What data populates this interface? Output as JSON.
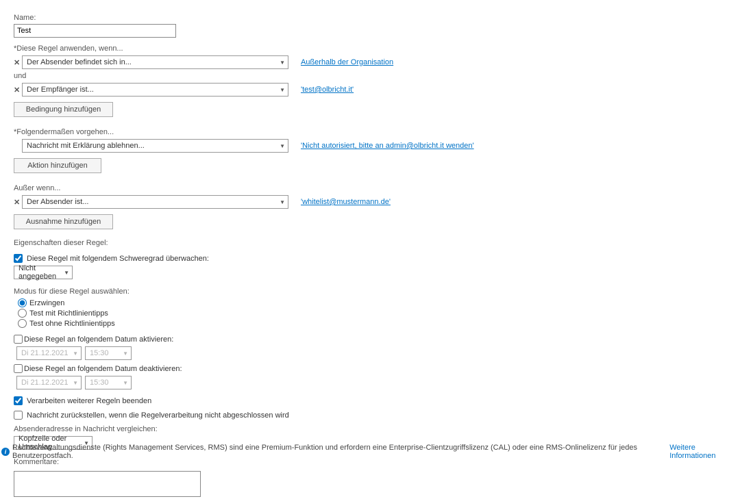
{
  "nameLabel": "Name:",
  "nameValue": "Test",
  "applyLabel": "*Diese Regel anwenden, wenn...",
  "condition1": {
    "dropdown": "Der Absender befindet sich in...",
    "link": "Außerhalb der Organisation"
  },
  "andLabel": "und",
  "condition2": {
    "dropdown": "Der Empfänger ist...",
    "link": "'test@olbricht.it'"
  },
  "addCondition": "Bedingung hinzufügen",
  "doLabel": "*Folgendermaßen vorgehen...",
  "action1": {
    "dropdown": "Nachricht mit Erklärung ablehnen...",
    "link": "'Nicht autorisiert, bitte an admin@olbricht.it wenden'"
  },
  "addAction": "Aktion hinzufügen",
  "exceptLabel": "Außer wenn...",
  "except1": {
    "dropdown": "Der Absender ist...",
    "link": "'whitelist@mustermann.de'"
  },
  "addException": "Ausnahme hinzufügen",
  "propsHeader": "Eigenschaften dieser Regel:",
  "monitorLabel": "Diese Regel mit folgendem Schweregrad überwachen:",
  "severityValue": "Nicht angegeben",
  "modeLabel": "Modus für diese Regel auswählen:",
  "mode1": "Erzwingen",
  "mode2": "Test mit Richtlinientipps",
  "mode3": "Test ohne Richtlinientipps",
  "activateLabel": "Diese Regel an folgendem Datum aktivieren:",
  "deactivateLabel": "Diese Regel an folgendem Datum deaktivieren:",
  "dateValue": "Di 21.12.2021",
  "timeValue": "15:30",
  "stopLabel": "Verarbeiten weiterer Regeln beenden",
  "deferLabel": "Nachricht zurückstellen, wenn die Regelverarbeitung nicht abgeschlossen wird",
  "compareLabel": "Absenderadresse in Nachricht vergleichen:",
  "compareValue": "Kopfzeile oder Umschlag",
  "commentsLabel": "Kommentare:",
  "footerText": "Rechteverwaltungsdienste (Rights Management Services, RMS) sind eine Premium-Funktion und erfordern eine Enterprise-Clientzugriffslizenz (CAL) oder eine RMS-Onlinelizenz für jedes Benutzerpostfach.",
  "footerLink": "Weitere Informationen"
}
